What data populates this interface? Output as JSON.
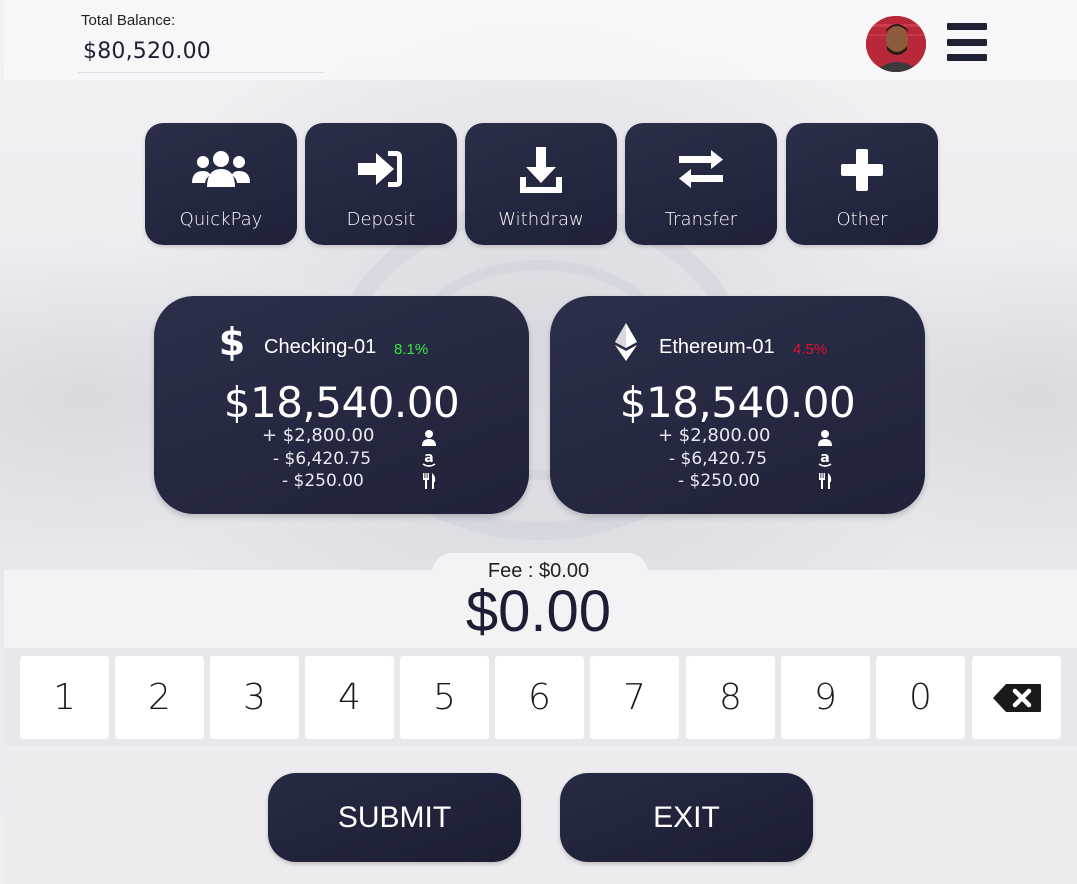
{
  "header": {
    "balance_label": "Total Balance:",
    "balance_value": "$80,520.00"
  },
  "actions": [
    {
      "label": "QuickPay",
      "icon": "users-icon"
    },
    {
      "label": "Deposit",
      "icon": "sign-in-icon"
    },
    {
      "label": "Withdraw",
      "icon": "download-icon"
    },
    {
      "label": "Transfer",
      "icon": "exchange-icon"
    },
    {
      "label": "Other",
      "icon": "plus-icon"
    }
  ],
  "accounts": [
    {
      "name": "Checking-01",
      "icon": "dollar-icon",
      "change": "8.1%",
      "change_color": "#39e642",
      "balance": "$18,540.00",
      "transactions": [
        {
          "amount": "+ $2,800.00",
          "icon": "user-icon"
        },
        {
          "amount": "- $6,420.75",
          "icon": "amazon-icon"
        },
        {
          "amount": "- $250.00",
          "icon": "utensils-icon"
        }
      ]
    },
    {
      "name": "Ethereum-01",
      "icon": "ethereum-icon",
      "change": "4.5%",
      "change_color": "#e0112b",
      "balance": "$18,540.00",
      "transactions": [
        {
          "amount": "+ $2,800.00",
          "icon": "user-icon"
        },
        {
          "amount": "- $6,420.75",
          "icon": "amazon-icon"
        },
        {
          "amount": "- $250.00",
          "icon": "utensils-icon"
        }
      ]
    }
  ],
  "entry": {
    "fee": "Fee : $0.00",
    "amount": "$0.00"
  },
  "keypad": [
    "1",
    "2",
    "3",
    "4",
    "5",
    "6",
    "7",
    "8",
    "9",
    "0"
  ],
  "buttons": {
    "submit": "SUBMIT",
    "exit": "EXIT"
  },
  "colors": {
    "navy": "#1f2238",
    "background": "#e9eaee"
  }
}
